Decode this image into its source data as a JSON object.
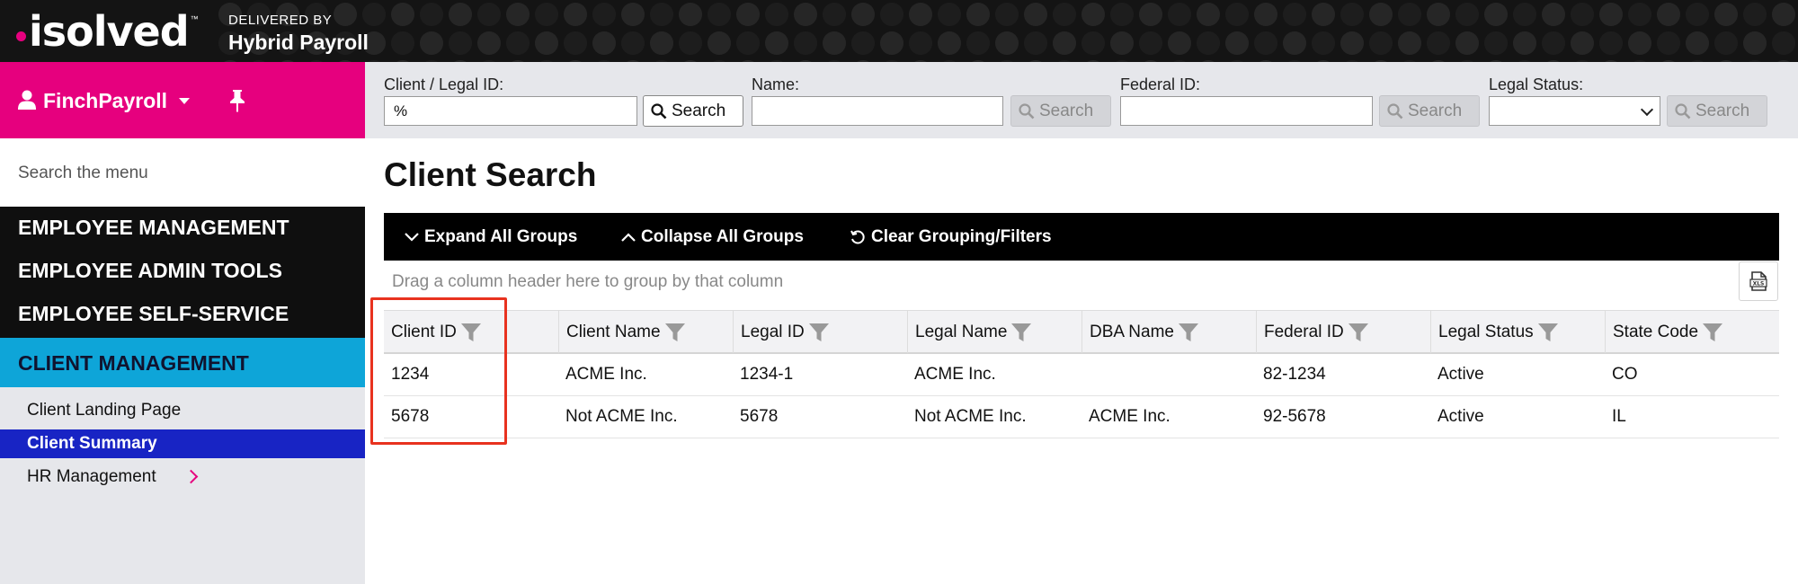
{
  "header": {
    "logo": "isolved",
    "delivered_by": "DELIVERED BY",
    "product": "Hybrid Payroll"
  },
  "sidebar": {
    "user": "FinchPayroll",
    "search_placeholder": "Search the menu",
    "sections": [
      {
        "label": "EMPLOYEE MANAGEMENT"
      },
      {
        "label": "EMPLOYEE ADMIN TOOLS"
      },
      {
        "label": "EMPLOYEE SELF-SERVICE"
      }
    ],
    "active_section": "CLIENT MANAGEMENT",
    "sub_items": [
      {
        "label": "Client Landing Page",
        "selected": false
      },
      {
        "label": "Client Summary",
        "selected": true
      },
      {
        "label": "HR Management",
        "selected": false,
        "has_children": true
      }
    ]
  },
  "search_bar": {
    "client_legal_id": {
      "label": "Client / Legal ID:",
      "value": "%"
    },
    "name": {
      "label": "Name:",
      "value": ""
    },
    "federal_id": {
      "label": "Federal ID:",
      "value": ""
    },
    "legal_status": {
      "label": "Legal Status:",
      "value": ""
    },
    "search_label": "Search"
  },
  "main": {
    "title": "Client Search",
    "toolbar": {
      "expand": "Expand All Groups",
      "collapse": "Collapse All Groups",
      "clear": "Clear Grouping/Filters"
    },
    "group_hint": "Drag a column header here to group by that column",
    "columns": [
      "Client ID",
      "Client Name",
      "Legal ID",
      "Legal Name",
      "DBA Name",
      "Federal ID",
      "Legal Status",
      "State Code"
    ],
    "rows": [
      [
        "1234",
        "ACME Inc.",
        "1234-1",
        "ACME Inc.",
        "",
        "82-1234",
        "Active",
        "CO"
      ],
      [
        "5678",
        "Not ACME Inc.",
        "5678",
        "Not ACME Inc.",
        "ACME Inc.",
        "92-5678",
        "Active",
        "IL"
      ]
    ]
  },
  "colors": {
    "brand_pink": "#e6007e",
    "active_blue": "#0ea5d8",
    "selected_item": "#1824c4",
    "highlight_red": "#e8321f"
  }
}
